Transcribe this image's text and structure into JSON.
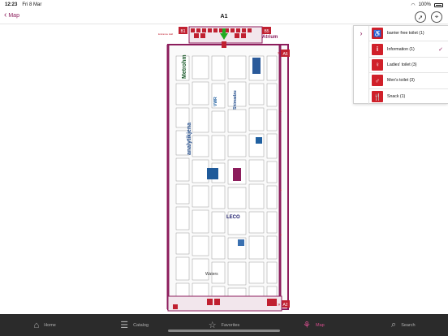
{
  "status_bar": {
    "time": "12:23",
    "date": "Fri 8 Mar",
    "battery": "100%"
  },
  "nav": {
    "back_label": "Map",
    "title": "A1"
  },
  "map": {
    "labels": {
      "b1": "B1",
      "b5": "B5",
      "a6": "A6",
      "a2": "A2",
      "a4": "A4",
      "atrium": "Atrium",
      "ent_left": "Entrance Hall",
      "ent_right": "Entrance Hall"
    },
    "exhibitors": [
      "Metrohm",
      "analytikjena",
      "Shimadzu",
      "LECO",
      "Waters",
      "VWR"
    ]
  },
  "legend": {
    "items": [
      {
        "label": "barrier free toilet (1)",
        "icon": "wheelchair-icon",
        "checked": false
      },
      {
        "label": "Information (1)",
        "icon": "info-icon",
        "checked": true
      },
      {
        "label": "Ladies' toilet (3)",
        "icon": "woman-icon",
        "checked": false
      },
      {
        "label": "Men's toilet (3)",
        "icon": "man-icon",
        "checked": false
      },
      {
        "label": "Snack (1)",
        "icon": "cutlery-icon",
        "checked": false
      }
    ],
    "check_glyph": "✓"
  },
  "tabs": [
    {
      "label": "Home",
      "icon": "home-icon",
      "active": false
    },
    {
      "label": "Catalog",
      "icon": "list-icon",
      "active": false
    },
    {
      "label": "Favorites",
      "icon": "star-icon",
      "active": false
    },
    {
      "label": "Map",
      "icon": "map-icon",
      "active": true
    },
    {
      "label": "Search",
      "icon": "search-icon",
      "active": false
    }
  ],
  "colors": {
    "accent": "#8c1d5c",
    "legend_icon": "#d0202a",
    "tab_active": "#d64d8d",
    "tabbar_bg": "#2b2b2b"
  }
}
